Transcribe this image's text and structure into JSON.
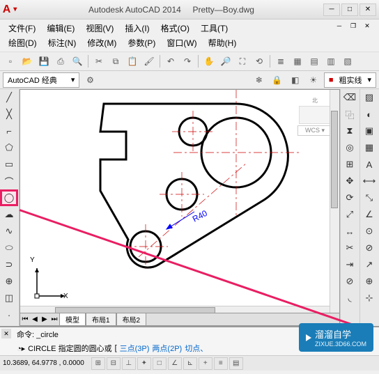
{
  "title": {
    "app": "Autodesk AutoCAD 2014",
    "file": "Pretty—Boy.dwg"
  },
  "menus": {
    "row1": [
      "文件(F)",
      "编辑(E)",
      "视图(V)",
      "插入(I)",
      "格式(O)",
      "工具(T)"
    ],
    "row2": [
      "绘图(D)",
      "标注(N)",
      "修改(M)",
      "参数(P)",
      "窗口(W)",
      "帮助(H)"
    ]
  },
  "workspace": {
    "label": "AutoCAD 经典"
  },
  "linetype": {
    "label": "粗实线"
  },
  "viewcube": {
    "top": "北",
    "wcs": "WCS"
  },
  "tabs": {
    "model": "模型",
    "layout1": "布局1",
    "layout2": "布局2"
  },
  "drawing": {
    "radius_label": "R40"
  },
  "ucs": {
    "x": "X",
    "y": "Y"
  },
  "cmd": {
    "history": "命令: _circle",
    "prompt": "CIRCLE 指定圆的圆心或",
    "opts": [
      "三点(3P)",
      "两点(2P)",
      "切点、"
    ]
  },
  "status": {
    "coords": "10.3689, 64.9778 , 0.0000"
  },
  "watermark": {
    "brand": "溜溜自学",
    "url": "ZIXUE.3D66.COM"
  }
}
